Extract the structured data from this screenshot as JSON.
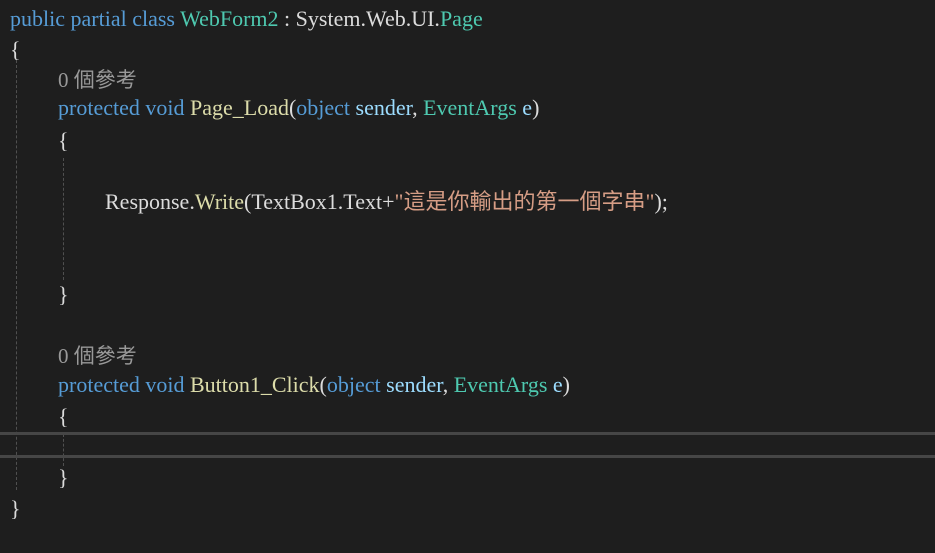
{
  "code": {
    "class_decl": {
      "kw_public": "public",
      "kw_partial": "partial",
      "kw_class": "class",
      "class_name": "WebForm2",
      "colon": " : ",
      "base_ns": "System.Web.UI.",
      "base_type": "Page"
    },
    "class_open": "{",
    "class_close": "}",
    "page_load": {
      "refs": "0 個參考",
      "kw_protected": "protected",
      "kw_void": "void",
      "name": "Page_Load",
      "open_paren": "(",
      "kw_object": "object",
      "p1": "sender",
      "comma": ", ",
      "type2": "EventArgs",
      "p2": "e",
      "close_paren": ")",
      "open": "{",
      "close": "}",
      "stmt": {
        "obj": "Response.",
        "method": "Write",
        "args_start": "(TextBox1.Text+",
        "string": "\"這是你輸出的第一個字串\"",
        "args_end": ");"
      }
    },
    "button1_click": {
      "refs": "0 個參考",
      "kw_protected": "protected",
      "kw_void": "void",
      "name": "Button1_Click",
      "open_paren": "(",
      "kw_object": "object",
      "p1": "sender",
      "comma": ", ",
      "type2": "EventArgs",
      "p2": "e",
      "close_paren": ")",
      "open": "{",
      "close": "}"
    }
  },
  "colors": {
    "background": "#1e1e1e",
    "keyword": "#569cd6",
    "type": "#4ec9b0",
    "method": "#dcdcaa",
    "parameter": "#9cdcfe",
    "string": "#d69d85",
    "codelens": "#999999"
  }
}
